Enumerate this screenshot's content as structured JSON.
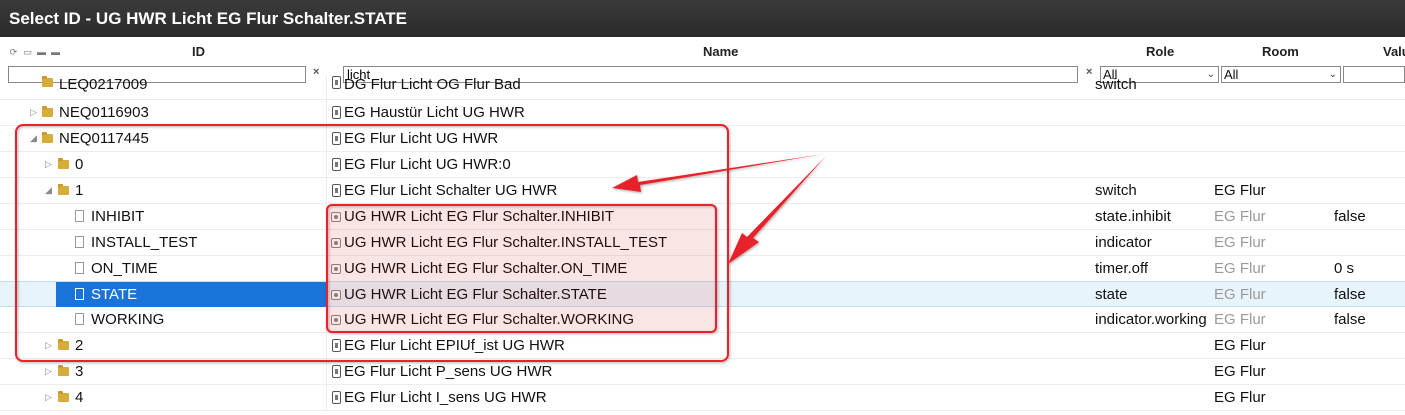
{
  "window": {
    "title": "Select ID - UG HWR Licht EG Flur Schalter.STATE"
  },
  "columns": {
    "id": "ID",
    "name": "Name",
    "role": "Role",
    "room": "Room",
    "value": "Valu"
  },
  "filters": {
    "id_value": "",
    "name_value": "licht",
    "clear_symbol": "×",
    "role_selected": "All",
    "room_selected": "All",
    "value_value": ""
  },
  "rows": [
    {
      "id": "LEQ0217009",
      "name": "DG Flur Licht OG Flur Bad",
      "role": "switch",
      "room": "",
      "value": ""
    },
    {
      "id": "NEQ0116903",
      "name": "EG Haustür Licht UG HWR",
      "role": "",
      "room": "",
      "value": ""
    },
    {
      "id": "NEQ0117445",
      "name": "EG Flur Licht UG HWR",
      "role": "",
      "room": "",
      "value": ""
    },
    {
      "id": "0",
      "name": "EG Flur Licht UG HWR:0",
      "role": "",
      "room": "",
      "value": ""
    },
    {
      "id": "1",
      "name": "EG Flur Licht Schalter UG HWR",
      "role": "switch",
      "room": "EG Flur",
      "value": ""
    },
    {
      "id": "INHIBIT",
      "name": "UG HWR Licht EG Flur Schalter.INHIBIT",
      "role": "state.inhibit",
      "room": "EG Flur",
      "value": "false"
    },
    {
      "id": "INSTALL_TEST",
      "name": "UG HWR Licht EG Flur Schalter.INSTALL_TEST",
      "role": "indicator",
      "room": "EG Flur",
      "value": ""
    },
    {
      "id": "ON_TIME",
      "name": "UG HWR Licht EG Flur Schalter.ON_TIME",
      "role": "timer.off",
      "room": "EG Flur",
      "value": "0 s"
    },
    {
      "id": "STATE",
      "name": "UG HWR Licht EG Flur Schalter.STATE",
      "role": "state",
      "room": "EG Flur",
      "value": "false"
    },
    {
      "id": "WORKING",
      "name": "UG HWR Licht EG Flur Schalter.WORKING",
      "role": "indicator.working",
      "room": "EG Flur",
      "value": "false"
    },
    {
      "id": "2",
      "name": "EG Flur Licht EPIUf_ist UG HWR",
      "role": "",
      "room": "EG Flur",
      "value": ""
    },
    {
      "id": "3",
      "name": "EG Flur Licht P_sens UG HWR",
      "role": "",
      "room": "EG Flur",
      "value": ""
    },
    {
      "id": "4",
      "name": "EG Flur Licht I_sens UG HWR",
      "role": "",
      "room": "EG Flur",
      "value": ""
    }
  ],
  "colors": {
    "annotation": "#e8202a",
    "selection": "#1a73d8",
    "titlebar": "#333333"
  },
  "icons": {
    "tree_toggle": "triangle-icon",
    "folder": "folder-icon",
    "state": "document-icon",
    "device": "device-icon"
  }
}
